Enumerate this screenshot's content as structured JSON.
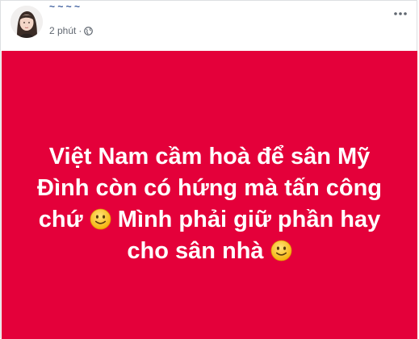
{
  "post": {
    "author_name": "~ ~ ~ ~",
    "time": "2 phút",
    "separator": "·",
    "privacy_icon": "globe-icon",
    "more_icon": "more-horizontal-icon",
    "background_color": "#e4003a",
    "text_color": "#ffffff",
    "text_segments": [
      "Việt Nam cầm hoà để sân Mỹ Đình còn có hứng mà tấn công chứ",
      "Mình phải giữ phần hay cho sân nhà"
    ],
    "emoji_icon": "slightly-smiling-face-icon"
  }
}
